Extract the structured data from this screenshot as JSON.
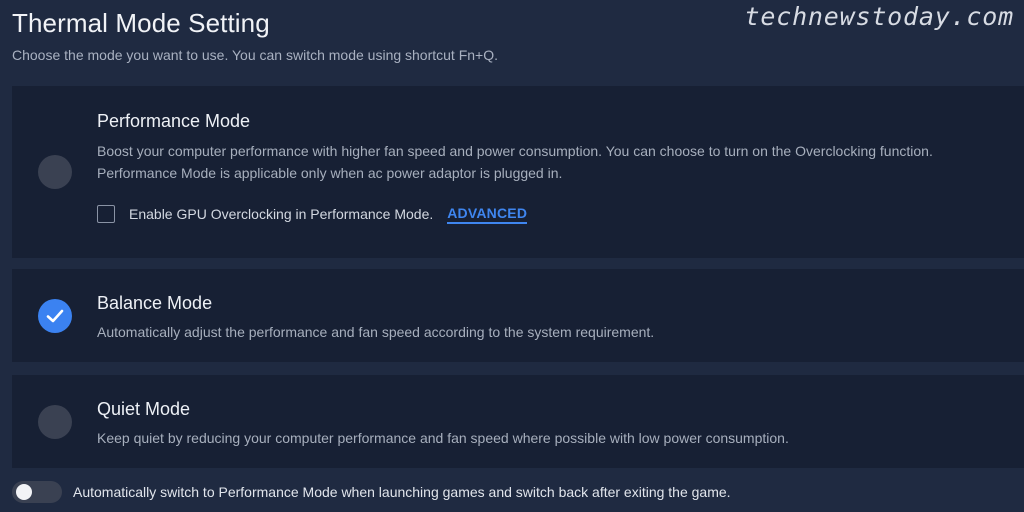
{
  "page": {
    "title": "Thermal Mode Setting",
    "subtitle": "Choose the mode you want to use. You can switch mode using shortcut Fn+Q."
  },
  "watermark": "technewstoday.com",
  "modes": [
    {
      "id": "performance",
      "title": "Performance Mode",
      "description": "Boost your computer performance with higher fan speed and power consumption. You can choose to turn on the Overclocking function. Performance Mode is applicable only when ac power adaptor is plugged in.",
      "selected": false,
      "gpu_overclock_label": "Enable GPU Overclocking in Performance Mode.",
      "gpu_overclock_checked": false,
      "advanced_label": "ADVANCED"
    },
    {
      "id": "balance",
      "title": "Balance Mode",
      "description": "Automatically adjust the performance and fan speed according to the system requirement.",
      "selected": true
    },
    {
      "id": "quiet",
      "title": "Quiet Mode",
      "description": "Keep quiet by reducing your computer performance and fan speed where possible with low power consumption.",
      "selected": false
    }
  ],
  "auto_switch": {
    "label": "Automatically switch to Performance Mode when launching games and switch back after exiting the game.",
    "enabled": false
  },
  "colors": {
    "background": "#1f2a41",
    "card": "#172034",
    "accent": "#3b82f1",
    "radio_off": "#3a4152"
  },
  "icons": {
    "selected_radio": "checkmark-icon"
  }
}
